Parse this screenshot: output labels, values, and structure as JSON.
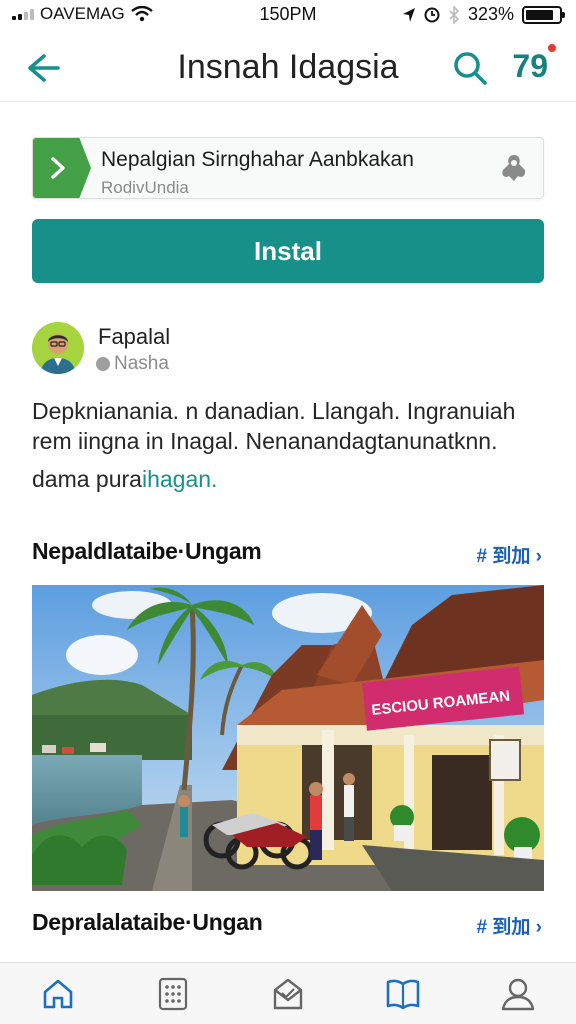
{
  "status_bar": {
    "carrier": "OAVEMAG",
    "time": "150PM",
    "battery_percent": "323%",
    "battery_level": 0.85
  },
  "nav": {
    "title": "Insnah Idagsia",
    "counter": "79"
  },
  "banner": {
    "title": "Nepalgian Sirnghahar Aanbkakan",
    "subtitle": "RodivUndia"
  },
  "install": {
    "label": "Instal"
  },
  "post": {
    "author": "Fapalal",
    "handle": "Nasha",
    "body_line1": "Depknianania. n danadian. Llangah. Ingranuiah",
    "body_line2": "rem iingna in Inagal. Nenanandagtanunatknn.",
    "body_line3_text": "dama pura",
    "body_line3_link": "ihagan."
  },
  "sections": [
    {
      "title": "Nepaldlataibe·Ungam",
      "more": "# 到加 ›"
    },
    {
      "title": "Depralalataibe·Ungan",
      "more": "# 到加 ›"
    }
  ],
  "photo": {
    "sign_text": "ESCIOU ROAMEAN"
  },
  "tabs": [
    {
      "icon": "home-icon",
      "active": true
    },
    {
      "icon": "grid-icon",
      "active": false
    },
    {
      "icon": "inbox-icon",
      "active": false
    },
    {
      "icon": "book-icon",
      "active": true
    },
    {
      "icon": "profile-icon",
      "active": false
    }
  ],
  "colors": {
    "accent": "#17908a",
    "banner_green": "#43a047",
    "link_blue": "#1d5fb4",
    "alert": "#e53935"
  }
}
